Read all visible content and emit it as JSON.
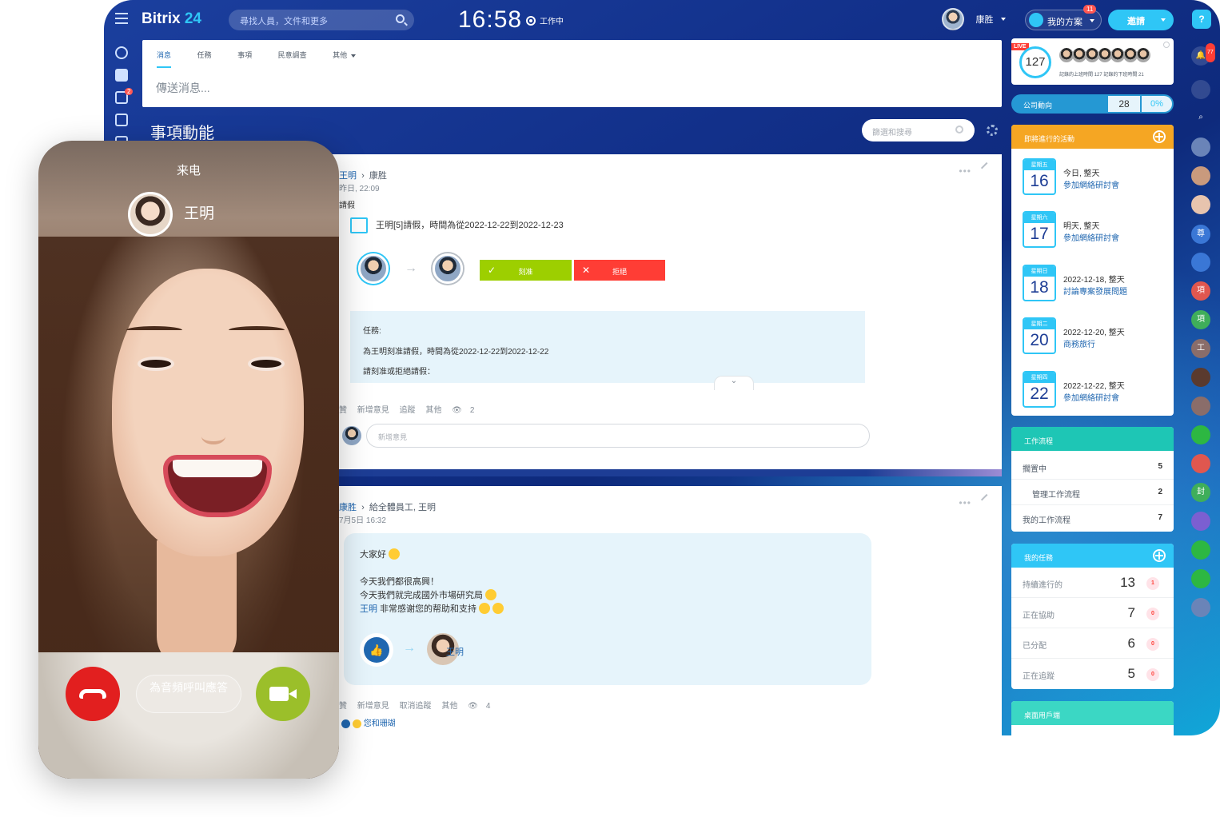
{
  "brand": {
    "name": "Bitrix",
    "num": "24"
  },
  "search": {
    "placeholder": "尋找人員，文件和更多"
  },
  "clock": {
    "time": "16:58",
    "status": "工作中"
  },
  "user": {
    "name": "康胜"
  },
  "plan": {
    "label": "我的方案",
    "badge": "11"
  },
  "invite": {
    "label": "邀請"
  },
  "help": {
    "label": "?"
  },
  "leftbar": {
    "chat_badge": "2"
  },
  "composer": {
    "tabs": [
      "消息",
      "任務",
      "事項",
      "民意調查",
      "其他"
    ],
    "placeholder": "傳送消息..."
  },
  "feed": {
    "title": "事項動能",
    "filter_placeholder": "篩選和搜尋"
  },
  "post1": {
    "from": "王明",
    "to": "康胜",
    "date": "昨日, 22:09",
    "label": "請假",
    "text": "王明[5]請假，時間為從2022-12-22到2022-12-23",
    "approve": "刻准",
    "reject": "拒絕",
    "task_title": "任務:",
    "task_line1": "為王明刻准請假，時間為從2022-12-22到2022-12-22",
    "task_line2": "請刻准或拒絕請假：",
    "actions": [
      "贊",
      "新增意見",
      "追蹤",
      "其他"
    ],
    "views": "2",
    "comment_placeholder": "新增意見"
  },
  "post2": {
    "from": "康胜",
    "to": "給全體員工, 王明",
    "date": "7月5日 16:32",
    "line1": "大家好",
    "line2": "今天我們都很高興！",
    "line3": "今天我們就完成國外市場研究局",
    "line4_name": "王明",
    "line4": "非常感谢您的帮助和支持",
    "recipient": "王明",
    "actions": [
      "贊",
      "新增意見",
      "取消追蹤",
      "其他"
    ],
    "views": "4",
    "likers": "您和珊瑚"
  },
  "live": {
    "tag": "LIVE",
    "count": "127",
    "sub": "記錄的上班時間 127   記錄的下班時間 21"
  },
  "company": {
    "label": "公司動向",
    "value": "28",
    "percent": "0%"
  },
  "events": {
    "title": "即將進行的活動",
    "accent": "#f5a623",
    "items": [
      {
        "dow": "星期五",
        "day": "16",
        "when": "今日, 整天",
        "what": "參加網絡研討會"
      },
      {
        "dow": "星期六",
        "day": "17",
        "when": "明天, 整天",
        "what": "參加網絡研討會"
      },
      {
        "dow": "星期日",
        "day": "18",
        "when": "2022-12-18, 整天",
        "what": "討論專案發展問題"
      },
      {
        "dow": "星期二",
        "day": "20",
        "when": "2022-12-20, 整天",
        "what": "商務旅行"
      },
      {
        "dow": "星期四",
        "day": "22",
        "when": "2022-12-22, 整天",
        "what": "參加網絡研討會"
      }
    ]
  },
  "workflow": {
    "title": "工作流程",
    "accent": "#1ec6b5",
    "rows": [
      {
        "label": "擱置中",
        "value": "5"
      },
      {
        "label": "管理工作流程",
        "value": "2"
      },
      {
        "label": "我的工作流程",
        "value": "7"
      }
    ]
  },
  "tasks": {
    "title": "我的任務",
    "accent": "#2fc6f6",
    "rows": [
      {
        "label": "持續進行的",
        "value": "13",
        "badge": "1"
      },
      {
        "label": "正在協助",
        "value": "7",
        "badge": "0"
      },
      {
        "label": "已分配",
        "value": "6",
        "badge": "0"
      },
      {
        "label": "正在追蹤",
        "value": "5",
        "badge": "0"
      }
    ]
  },
  "desktop": {
    "title": "桌面用戶端",
    "accent": "#3bd7c4"
  },
  "rightbar": {
    "notify_badge": "77",
    "items": [
      {
        "icon": "bell-icon",
        "text": "",
        "color": "rgba(255,255,255,0.15)"
      },
      {
        "icon": "chat-icon",
        "text": "",
        "color": "rgba(255,255,255,0.15)"
      },
      {
        "icon": "search-icon",
        "text": "",
        "color": "transparent"
      },
      {
        "icon": "user-avatar-icon",
        "text": "",
        "color": "#6a84b8"
      },
      {
        "icon": "user-avatar-icon",
        "text": "",
        "color": "#c99a7d"
      },
      {
        "icon": "user-avatar-icon",
        "text": "",
        "color": "#e7c4ae"
      },
      {
        "icon": "group-chat-icon",
        "text": "尊",
        "color": "#3a77d6"
      },
      {
        "icon": "group-icon",
        "text": "",
        "color": "#3a77d6"
      },
      {
        "icon": "group-chat-icon",
        "text": "項",
        "color": "#e0574f"
      },
      {
        "icon": "group-chat-icon",
        "text": "項",
        "color": "#3fae5a"
      },
      {
        "icon": "group-chat-icon",
        "text": "工",
        "color": "#8a6d6a"
      },
      {
        "icon": "user-avatar-icon",
        "text": "",
        "color": "#5a3a2e"
      },
      {
        "icon": "group-icon",
        "text": "",
        "color": "#8a6d6a"
      },
      {
        "icon": "whatsapp-icon",
        "text": "",
        "color": "#2db742"
      },
      {
        "icon": "group-icon",
        "text": "",
        "color": "#e0574f"
      },
      {
        "icon": "group-chat-icon",
        "text": "封",
        "color": "#3fae5a"
      },
      {
        "icon": "viber-icon",
        "text": "",
        "color": "#7b5fd1"
      },
      {
        "icon": "whatsapp-icon",
        "text": "",
        "color": "#2db742"
      },
      {
        "icon": "whatsapp-icon",
        "text": "",
        "color": "#2db742"
      },
      {
        "icon": "user-avatar-icon",
        "text": "",
        "color": "#6a84b8"
      }
    ]
  },
  "call": {
    "incoming": "来电",
    "caller": "王明",
    "audio_answer": "為音頻呼叫應答"
  }
}
